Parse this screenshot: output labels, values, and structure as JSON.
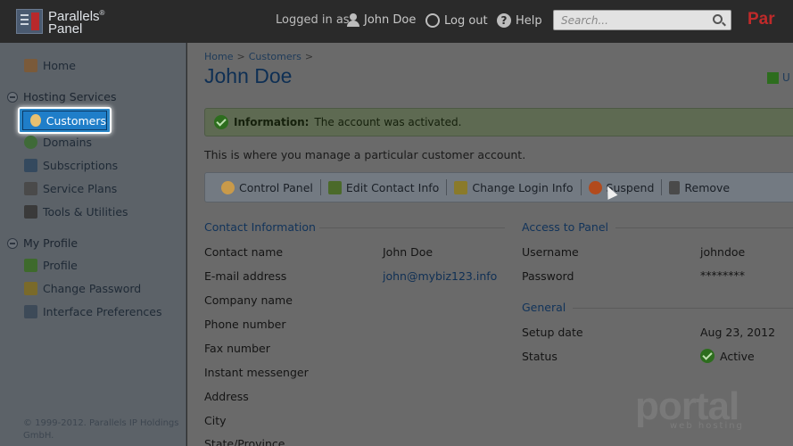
{
  "header": {
    "logo_line1": "Parallels",
    "logo_line2": "Panel",
    "logged_in_as": "Logged in as",
    "user_name": "John Doe",
    "logout": "Log out",
    "help": "Help",
    "search_placeholder": "Search...",
    "brand_right": "Par"
  },
  "sidebar": {
    "home": "Home",
    "hosting_group": "Hosting Services",
    "customers": "Customers",
    "domains": "Domains",
    "subscriptions": "Subscriptions",
    "service_plans": "Service Plans",
    "tools": "Tools & Utilities",
    "profile_group": "My Profile",
    "profile": "Profile",
    "change_password": "Change Password",
    "interface_prefs": "Interface Preferences",
    "copyright": "© 1999-2012. Parallels IP Holdings GmbH."
  },
  "main": {
    "breadcrumb": [
      "Home",
      "Customers"
    ],
    "breadcrumb_sep": ">",
    "title": "John Doe",
    "top_right_link": "U",
    "message_label": "Information:",
    "message_text": "The account was activated.",
    "intro": "This is where you manage a particular customer account.",
    "toolbar": {
      "control_panel": "Control Panel",
      "edit_contact": "Edit Contact Info",
      "change_login": "Change Login Info",
      "suspend": "Suspend",
      "remove": "Remove"
    },
    "contact": {
      "title": "Contact Information",
      "labels": [
        "Contact name",
        "E-mail address",
        "Company name",
        "Phone number",
        "Fax number",
        "Instant messenger",
        "Address",
        "City",
        "State/Province"
      ],
      "contact_name": "John Doe",
      "email": "john@mybiz123.info"
    },
    "access": {
      "title": "Access to Panel",
      "username_label": "Username",
      "username": "johndoe",
      "password_label": "Password",
      "password": "********"
    },
    "general": {
      "title": "General",
      "setup_label": "Setup date",
      "setup_date": "Aug 23, 2012",
      "status_label": "Status",
      "status": "Active"
    },
    "watermark": "portal",
    "watermark_sub": "web hosting"
  },
  "colors": {
    "accent": "#1f7ec9",
    "link": "#0f2f54",
    "success": "#2d6d1e",
    "brand": "#c02a2a"
  }
}
